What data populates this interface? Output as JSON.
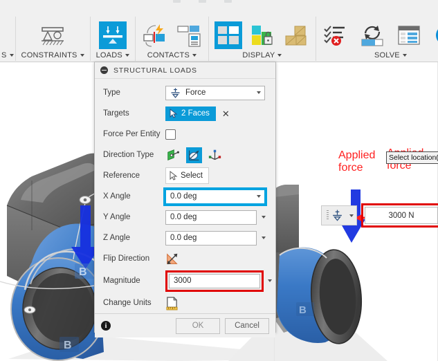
{
  "ribbon": {
    "panels": [
      {
        "id": "partial-left",
        "label": "",
        "label_has_caret": true,
        "icons": []
      },
      {
        "id": "constraints",
        "label": "CONSTRAINTS",
        "label_has_caret": true,
        "icons": [
          {
            "name": "structural-constraints-icon",
            "selected": false
          }
        ]
      },
      {
        "id": "loads",
        "label": "LOADS",
        "label_has_caret": true,
        "icons": [
          {
            "name": "structural-loads-icon",
            "selected": true
          }
        ]
      },
      {
        "id": "contacts",
        "label": "CONTACTS",
        "label_has_caret": true,
        "icons": [
          {
            "name": "automatic-contacts-icon",
            "selected": false
          },
          {
            "name": "manage-contacts-icon",
            "selected": false
          }
        ]
      },
      {
        "id": "display",
        "label": "DISPLAY",
        "label_has_caret": true,
        "icons": [
          {
            "name": "display-grid-icon",
            "selected": true
          },
          {
            "name": "display-lock-icon",
            "selected": false
          },
          {
            "name": "display-mesh-icon",
            "selected": false
          }
        ]
      },
      {
        "id": "solve",
        "label": "SOLVE",
        "label_has_caret": true,
        "icons": [
          {
            "name": "pre-check-icon",
            "selected": false
          },
          {
            "name": "solve-icon",
            "selected": false
          },
          {
            "name": "results-icon",
            "selected": false
          },
          {
            "name": "info-icon",
            "selected": false
          }
        ]
      }
    ]
  },
  "dialog": {
    "title": "STRUCTURAL LOADS",
    "collapse_icon": "collapse-minus-icon",
    "rows": {
      "type": {
        "label": "Type",
        "value": "Force",
        "icon": "force-icon"
      },
      "targets": {
        "label": "Targets",
        "value": "2 Faces",
        "icon": "cursor-select-icon",
        "clear_icon": "clear-x-icon"
      },
      "force_per_entity": {
        "label": "Force Per Entity",
        "checked": false
      },
      "direction_type": {
        "label": "Direction Type",
        "options": [
          {
            "name": "normal-to-face-icon",
            "selected": false
          },
          {
            "name": "angles-direction-icon",
            "selected": true
          },
          {
            "name": "vector-components-icon",
            "selected": false
          }
        ]
      },
      "reference": {
        "label": "Reference",
        "value": "Select",
        "icon": "cursor-select-icon"
      },
      "x_angle": {
        "label": "X Angle",
        "value": "0.0 deg",
        "highlighted": true
      },
      "y_angle": {
        "label": "Y Angle",
        "value": "0.0 deg",
        "highlighted": false
      },
      "z_angle": {
        "label": "Z Angle",
        "value": "0.0 deg",
        "highlighted": false
      },
      "flip_direction": {
        "label": "Flip Direction",
        "icon": "flip-direction-icon"
      },
      "magnitude": {
        "label": "Magnitude",
        "value": "3000",
        "highlighted_red": true
      },
      "change_units": {
        "label": "Change Units",
        "icon": "change-units-icon"
      }
    },
    "footer": {
      "info_icon": "info-icon",
      "ok_label": "OK",
      "cancel_label": "Cancel"
    }
  },
  "annotations": {
    "applied_force": {
      "line1": "Applied",
      "line2": "force",
      "color": "#ff1f1f",
      "arrow_icon": "red-arrow-left-icon"
    },
    "tooltip": {
      "text": "Select location("
    }
  },
  "canvas_field": {
    "handle_icon": "force-icon",
    "value": "3000 N",
    "highlighted_red": true
  },
  "model": {
    "force_arrow_icon": "blue-force-arrow-icon",
    "colors": {
      "highlighted_face": "#2f6fc4",
      "body": "#6e6e6e",
      "accent": "#0b9bd8",
      "red": "#e00000"
    }
  }
}
